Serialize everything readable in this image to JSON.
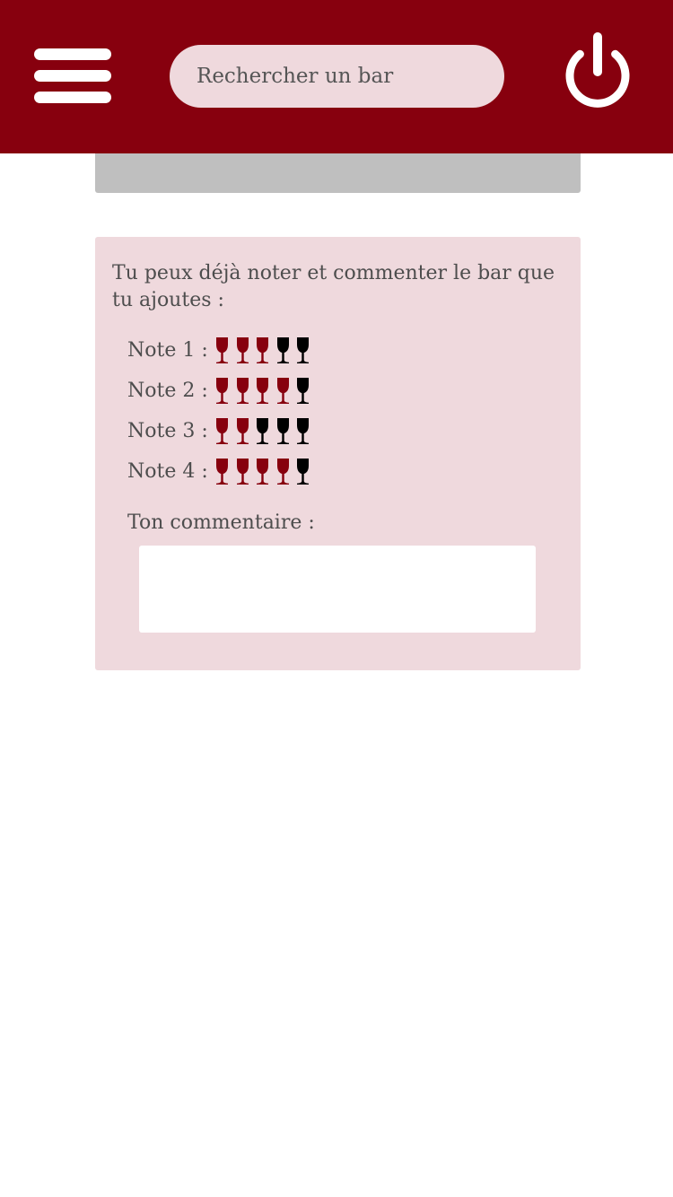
{
  "header": {
    "search_placeholder": "Rechercher un bar",
    "background_color": "#87000e",
    "menu_icon": "hamburger-menu-icon",
    "power_icon": "power-icon"
  },
  "rating_card": {
    "intro": "Tu peux déjà noter et commenter le bar que tu ajoutes :",
    "max_rating": 5,
    "glass_icon": "wine-glass-icon",
    "filled_color": "#87000e",
    "empty_color": "#000000",
    "notes": [
      {
        "label": "Note 1 :",
        "rating": 3
      },
      {
        "label": "Note 2 :",
        "rating": 4
      },
      {
        "label": "Note 3 :",
        "rating": 2
      },
      {
        "label": "Note 4 :",
        "rating": 4
      }
    ],
    "comment_label": "Ton commentaire :",
    "comment_value": ""
  }
}
